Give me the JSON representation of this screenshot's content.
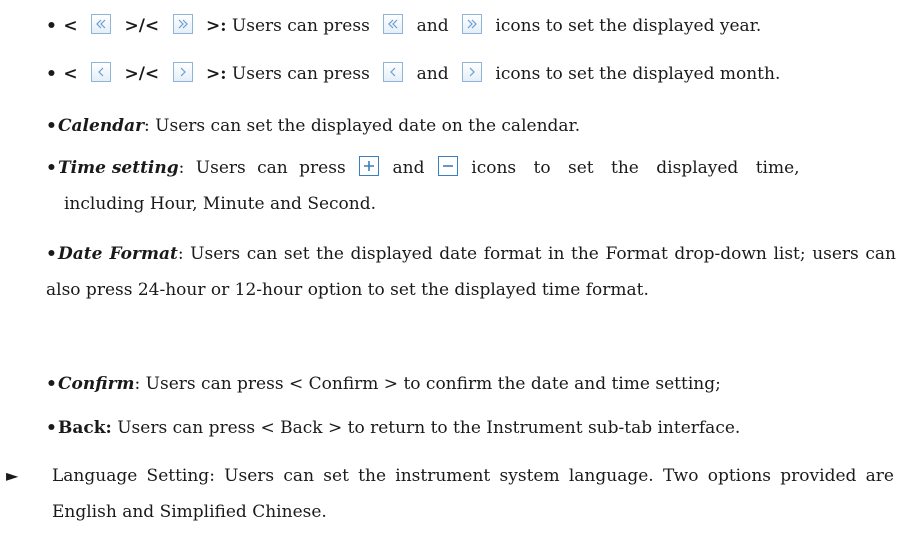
{
  "bullets": {
    "year": {
      "lt": "<",
      "sep": ">/<",
      "gt": ">:",
      "text_a": "Users can press",
      "text_b": "and",
      "text_c": "icons to set the displayed year."
    },
    "month": {
      "lt": "<",
      "sep": ">/<",
      "gt": ">:",
      "text_a": "Users can press",
      "text_b": "and",
      "text_c": "icons to set the displayed month."
    },
    "calendar": {
      "term": "Calendar",
      "text": ": Users can set the displayed date on the calendar."
    },
    "time": {
      "term": "Time setting",
      "text_a": ": Users can press",
      "text_b": "and",
      "text_c": "icons to set the displayed time,",
      "text_d": "including Hour, Minute and Second."
    },
    "format": {
      "term": "Date Format",
      "text": ": Users can set the displayed date format in the Format drop-down list; users can also press 24-hour or 12-hour option to set the displayed time format."
    },
    "confirm": {
      "term": "Confirm",
      "text": ": Users can press < Confirm > to confirm the date and time setting;"
    },
    "back": {
      "term": "Back:",
      "text": " Users can press < Back > to return to the Instrument sub-tab interface."
    }
  },
  "language": {
    "term": "Language Setting",
    "text_a": ": Users can set the instrument system language. Two options provided are ",
    "opt1": "English",
    "text_b": " and ",
    "opt2": "Simplified Chinese",
    "text_c": "."
  },
  "icons": [
    "double-left-icon",
    "double-right-icon",
    "single-left-icon",
    "single-right-icon",
    "plus-icon",
    "minus-icon",
    "arrow-bullet-icon"
  ],
  "colors": {
    "icon_border": "#8fb4d8",
    "icon_glyph": "#3a7fc2"
  }
}
